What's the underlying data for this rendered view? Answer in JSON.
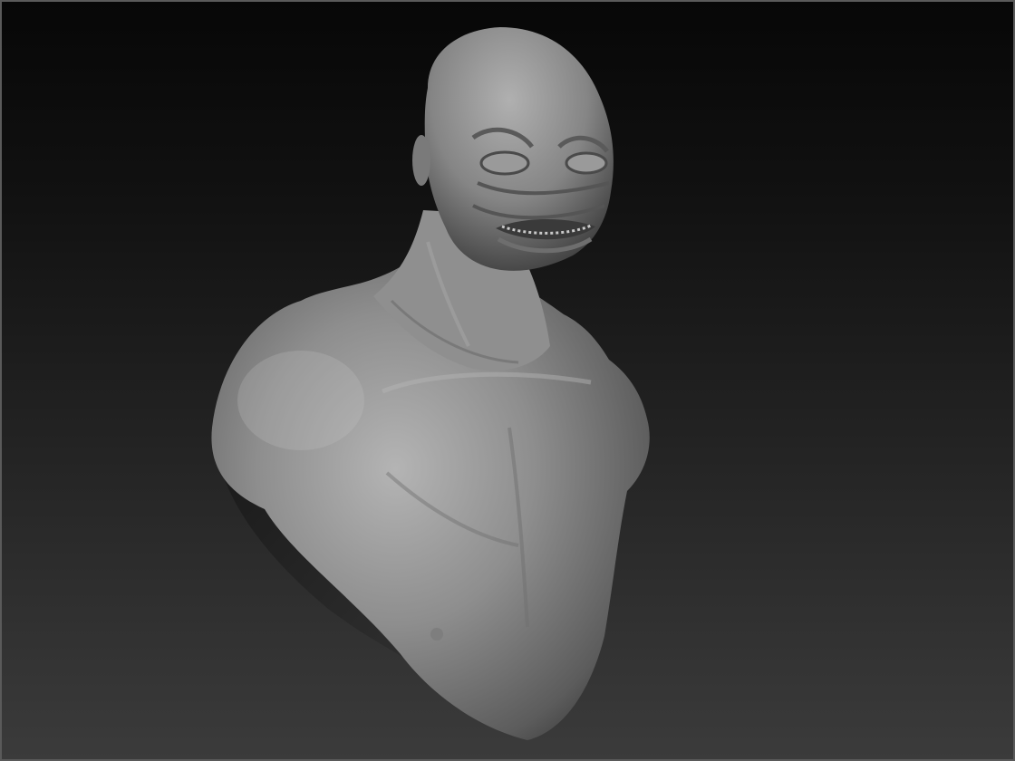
{
  "viewport": {
    "background_top": "#070707",
    "background_bottom": "#3b3b3b",
    "frame_border": "#5a5a5a"
  },
  "model": {
    "material_color": "#8c8c8c",
    "highlight_color": "#b8b8b8",
    "shadow_color": "#2a2a2a"
  }
}
